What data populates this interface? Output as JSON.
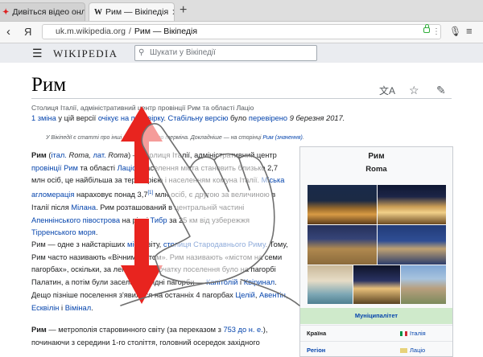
{
  "browser": {
    "tabs": [
      {
        "label": "Дивіться відео онлай",
        "active": false
      },
      {
        "label": "Рим — Вікіпедія",
        "active": true
      }
    ],
    "address": {
      "host": "uk.m.wikipedia.org",
      "separator": "/",
      "title": "Рим — Вікіпедія"
    },
    "yandex_label": "Я"
  },
  "wiki": {
    "logo": "WIKIPEDIA",
    "search_placeholder": "Шукати у Вікіпедії"
  },
  "article": {
    "title": "Рим",
    "tagline": "Столиця Італії, адміністративний центр провінції Рим та області Лаціо",
    "revision": {
      "part1": "1 зміна",
      "part2": " у цій версії ",
      "part3": "очікує на перевірку",
      "part4": ". ",
      "part5": "Стабільну версію",
      "part6": " було ",
      "part7": "перевірено",
      "part8": " 9 березня 2017."
    },
    "hatnote": {
      "part1": "У Вікіпедії є статті про інші значення цього терміна. Докладніше — на сторінці ",
      "part2": "Рим (значення)",
      "part3": "."
    },
    "p1": {
      "b1": "Рим",
      "t1": " (",
      "l1": "італ.",
      "t2": " Roma, ",
      "l2": "лат.",
      "t3": " ",
      "l3": "Roma",
      "t4": ") — столиця Італії, адміністративний центр ",
      "l4": "провінції Рим",
      "t5": " та області ",
      "l5": "Лаціо",
      "t6": ". Населення міста становить близько 2,7 млн осіб, це найбільша за територією і населенням комуна Італії. ",
      "l6": "Міська агломерація",
      "t7": " нараховує понад 3,7",
      "sup": "[1]",
      "t8": " млн осіб, є другою за величиною в Італії після ",
      "l7": "Мілана",
      "t9": ". Рим розташований в центральній частині ",
      "l8": "Апеннінського півострова",
      "t10": " на річці ",
      "l9": "Тибр",
      "t11": " за 25 км від узбережжя ",
      "l10": "Тірренського моря",
      "t12": "."
    },
    "p2": {
      "t1": "Рим — одне з найстаріших ",
      "l1": "міст",
      "t2": " світу, ",
      "l2": "столиця Стародавнього Риму",
      "t3": ". Тому, Рим часто називають «Вічним містом». Рим називають «містом на семи пагорбах», оскільки, за легендою, спочатку поселення було на пагорбі Палатин, а потім були заселені сусідні пагорби — ",
      "l3": "Капітолій",
      "t4": " і ",
      "l4": "Квіринал",
      "t5": ". Дещо пізніше поселення з'явилися на останніх 4 пагорбах ",
      "l5": "Целій",
      "t6": ", ",
      "l6": "Авентін",
      "t7": ", ",
      "l7": "Есквілін",
      "t8": " і ",
      "l8": "Вімінал",
      "t9": "."
    },
    "p3": {
      "b1": "Рим",
      "t1": " — метрополія старовинного світу (за переказом з ",
      "l1": "753 до н. е.",
      "t2": "), починаючи з середини 1-го століття, головний осередок західного"
    }
  },
  "infobox": {
    "title": "Рим",
    "subtitle": "Roma",
    "band": "Муніципалітет",
    "rows": [
      {
        "label": "Країна",
        "value": "Італія"
      },
      {
        "label": "Регіон",
        "value": "Лаціо"
      }
    ]
  },
  "colors": {
    "link": "#0645ad",
    "gesture_arrow": "#e8241f",
    "infobox_band": "#cfeacb"
  },
  "gesture": {
    "type": "vertical-swipe",
    "hand-icon": "hand-swipe-icon",
    "arrows": [
      "arrow-up-icon",
      "arrow-down-icon"
    ]
  }
}
